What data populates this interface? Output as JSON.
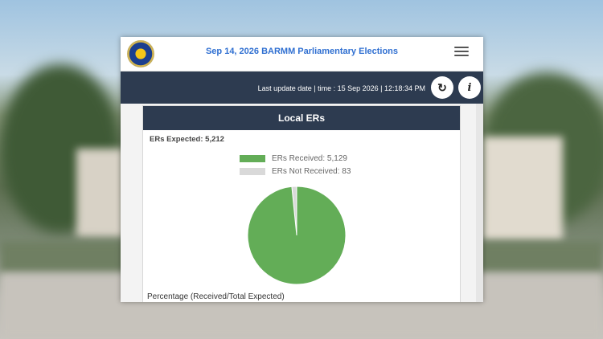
{
  "header": {
    "title": "Sep 14, 2026 BARMM Parliamentary Elections"
  },
  "update_bar": {
    "text": "Last update date | time : 15 Sep 2026 | 12:18:34 PM"
  },
  "card": {
    "title": "Local ERs",
    "expected_text": "ERs Expected: 5,212",
    "footer_text": "Percentage (Received/Total Expected)"
  },
  "chart_data": {
    "type": "pie",
    "title": "Local ERs",
    "slices": [
      {
        "label": "ERs Received: 5,129",
        "value": 5129,
        "color": "#63ad57"
      },
      {
        "label": "ERs Not Received: 83",
        "value": 83,
        "color": "#d9d9d9"
      }
    ],
    "legend": "top"
  },
  "icons": {
    "refresh": "refresh-icon",
    "info": "info-icon",
    "menu": "hamburger-menu-icon"
  }
}
